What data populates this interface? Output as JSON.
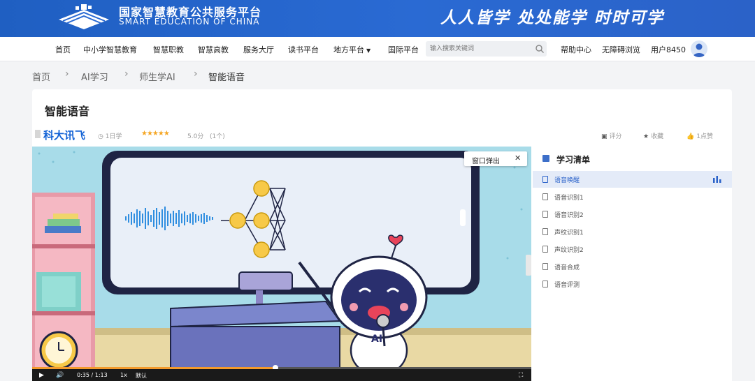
{
  "header": {
    "brand_cn": "国家智慧教育公共服务平台",
    "brand_en": "SMART EDUCATION OF CHINA",
    "slogan": "人人皆学 处处能学 时时可学",
    "colors": {
      "banner": "#2a6ad3",
      "accent": "#1463d6"
    }
  },
  "nav": {
    "items": [
      "首页",
      "中小学智慧教育",
      "智慧职教",
      "智慧高教",
      "服务大厅",
      "读书平台",
      "地方平台",
      "国际平台"
    ],
    "search_placeholder": "输入搜索关键词",
    "help": "帮助中心",
    "accessible": "无障碍浏览",
    "user": "用户8450"
  },
  "breadcrumb": [
    "首页",
    "AI学习",
    "师生学AI",
    "智能语音"
  ],
  "course": {
    "title": "智能语音",
    "vendor": "科大讯飞",
    "learners": "1日学",
    "stars": "★★★★★",
    "rating_value": 5.0,
    "rating": "5.0分",
    "reviews": "(1个)",
    "actions": {
      "rate": "评分",
      "favorite": "收藏",
      "like": "1点赞"
    }
  },
  "player": {
    "popout": "窗口弹出",
    "current_time": "0:35",
    "separator": "/",
    "duration": "1:13",
    "progress": 0.487,
    "speed": "1x",
    "quality": "默认",
    "screen_text": "AI"
  },
  "sidebar": {
    "title": "学习清单",
    "lessons": [
      "语音唤醒",
      "语音识别1",
      "语音识别2",
      "声纹识别1",
      "声纹识别2",
      "语音合成",
      "语音评测"
    ],
    "active_index": 0
  }
}
